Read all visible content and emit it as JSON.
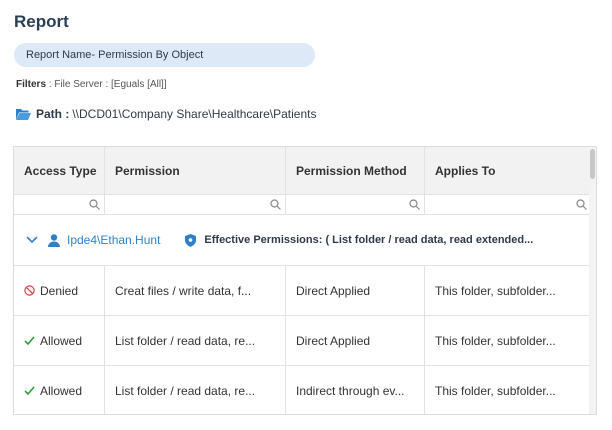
{
  "report": {
    "title": "Report",
    "name_pill": "Report Name- Permission By Object",
    "filters_label": "Filters",
    "filters_value": " : File Server : [Eguals [All]]",
    "path_label": "Path :",
    "path_value": "\\\\DCD01\\Company Share\\Healthcare\\Patients"
  },
  "grid": {
    "columns": [
      "Access Type",
      "Permission",
      "Permission Method",
      "Applies To"
    ],
    "group": {
      "user": "Ipde4\\Ethan.Hunt",
      "effective": "Effective Permissions: ( List folder / read data, read extended..."
    },
    "rows": [
      {
        "access": "Denied",
        "permission": "Creat files / write data, f...",
        "method": "Direct Applied",
        "applies": "This folder, subfolder..."
      },
      {
        "access": "Allowed",
        "permission": "List folder / read data, re...",
        "method": "Direct Applied",
        "applies": "This folder, subfolder..."
      },
      {
        "access": "Allowed",
        "permission": "List folder / read data, re...",
        "method": "Indirect through ev...",
        "applies": "This folder, subfolder..."
      }
    ]
  },
  "colors": {
    "denied": "#d0404c",
    "allowed": "#2c9a3a",
    "accent": "#2f80c7"
  }
}
